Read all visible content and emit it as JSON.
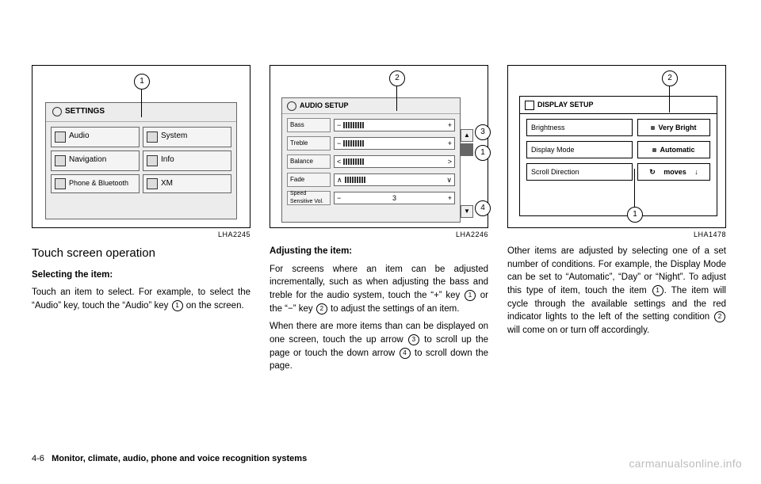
{
  "figures": {
    "f1": {
      "caption": "LHA2245",
      "screen_title": "SETTINGS",
      "buttons": [
        "Audio",
        "System",
        "Navigation",
        "Info",
        "Phone & Bluetooth",
        "XM"
      ],
      "callout1": "1"
    },
    "f2": {
      "caption": "LHA2246",
      "screen_title": "AUDIO SETUP",
      "rows": [
        {
          "label": "Bass",
          "left": "−",
          "right": "+"
        },
        {
          "label": "Treble",
          "left": "−",
          "right": "+"
        },
        {
          "label": "Balance",
          "left": "<",
          "right": ">"
        },
        {
          "label": "Fade",
          "left": "∧",
          "right": "∨"
        },
        {
          "label": "Speed Sensitive Vol.",
          "left": "−",
          "mid": "3",
          "right": "+"
        }
      ],
      "callouts": {
        "c1": "1",
        "c2": "2",
        "c3": "3",
        "c4": "4"
      }
    },
    "f3": {
      "caption": "LHA1478",
      "screen_title": "DISPLAY SETUP",
      "rows": [
        {
          "label": "Brightness",
          "value": "Very Bright"
        },
        {
          "label": "Display Mode",
          "value": "Automatic"
        },
        {
          "label": "Scroll Direction",
          "value": "moves",
          "icon": "↻",
          "arrow": "↓"
        }
      ],
      "callouts": {
        "c1": "1",
        "c2": "2"
      }
    }
  },
  "col1": {
    "heading": "Touch screen operation",
    "sub1": "Selecting the item:",
    "p1a": "Touch an item to select. For example, to select the “Audio” key, touch the “Audio” key ",
    "p1c": " on the screen.",
    "n1": "1"
  },
  "col2": {
    "sub": "Adjusting the item:",
    "p1a": "For screens where an item can be adjusted incrementally, such as when adjusting the bass and treble for the audio system, touch the “+” key ",
    "n1": "1",
    "p1b": " or the “−” key ",
    "n2": "2",
    "p1c": " to adjust the settings of an item.",
    "p2a": "When there are more items than can be displayed on one screen, touch the up arrow ",
    "n3": "3",
    "p2b": " to scroll up the page or touch the down arrow ",
    "n4": "4",
    "p2c": " to scroll down the page."
  },
  "col3": {
    "p1a": "Other items are adjusted by selecting one of a set number of conditions. For example, the Display Mode can be set to “Automatic”, “Day” or “Night”. To adjust this type of item, touch the item ",
    "n1": "1",
    "p1b": ". The item will cycle through the available settings and the red indicator lights to the left of the setting condition ",
    "n2": "2",
    "p1c": " will come on or turn off accordingly."
  },
  "footer": {
    "page": "4-6",
    "section": "Monitor, climate, audio, phone and voice recognition systems"
  },
  "watermark": "carmanualsonline.info"
}
